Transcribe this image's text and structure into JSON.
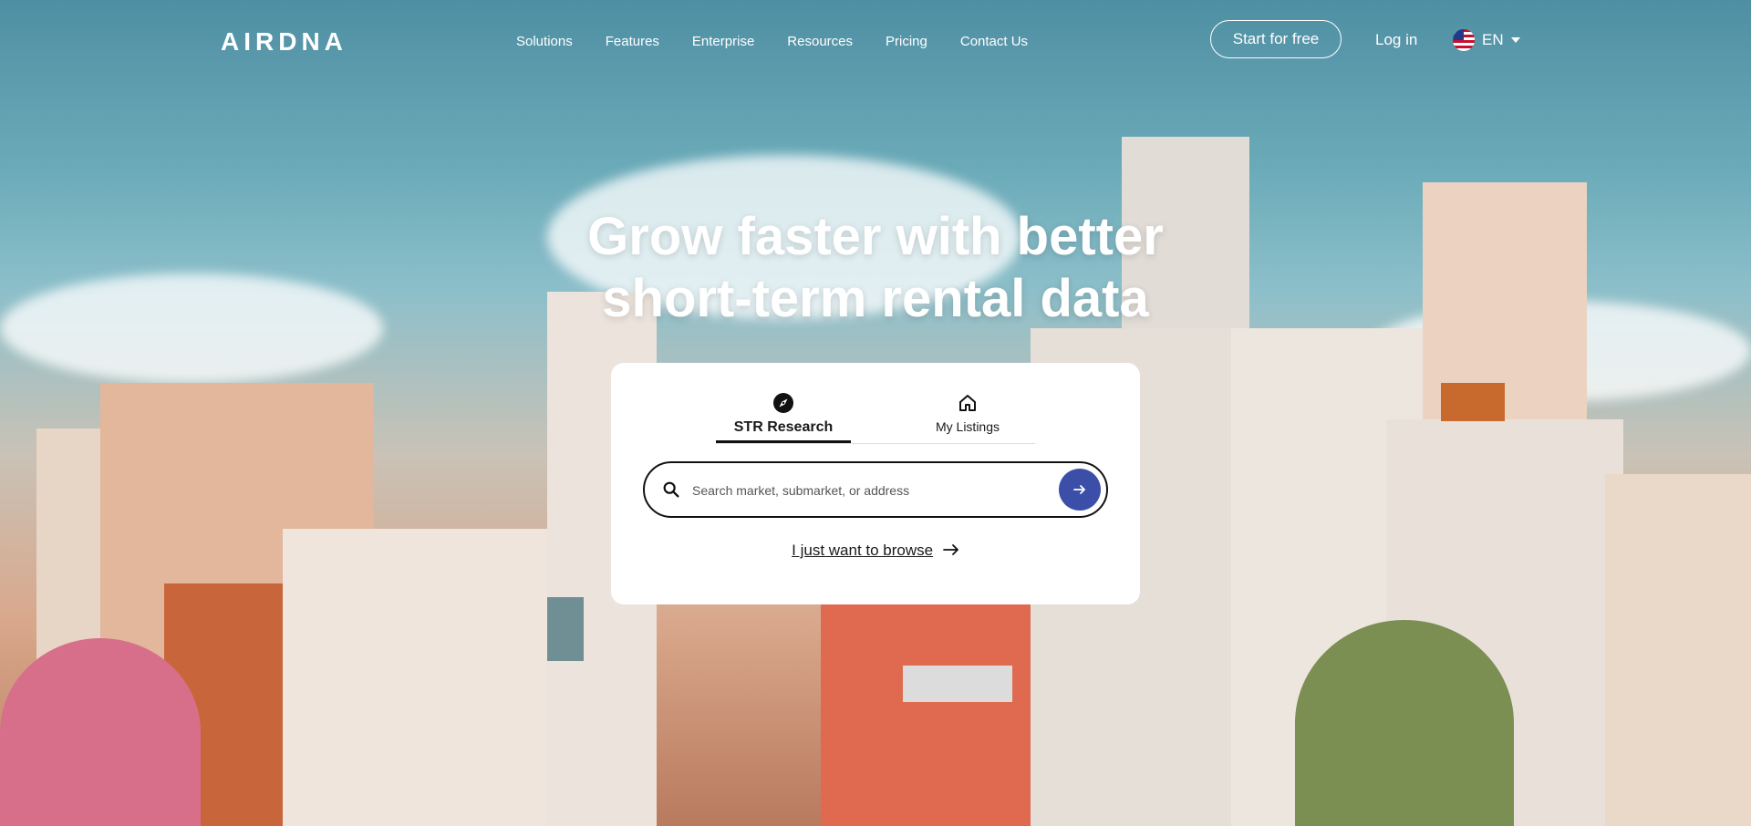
{
  "brand": {
    "logo_text": "AIRDNA"
  },
  "nav": {
    "items": [
      "Solutions",
      "Features",
      "Enterprise",
      "Resources",
      "Pricing",
      "Contact Us"
    ],
    "start_label": "Start for free",
    "login_label": "Log in",
    "language": "EN"
  },
  "hero": {
    "headline_line1": "Grow faster with better",
    "headline_line2": "short-term rental data"
  },
  "search_card": {
    "tabs": [
      {
        "label": "STR Research",
        "icon": "compass-icon",
        "active": true
      },
      {
        "label": "My Listings",
        "icon": "home-icon",
        "active": false
      }
    ],
    "search_placeholder": "Search market, submarket, or address",
    "browse_label": "I just want to browse"
  },
  "colors": {
    "accent": "#3c4fa8",
    "text": "#1a1a1a"
  }
}
